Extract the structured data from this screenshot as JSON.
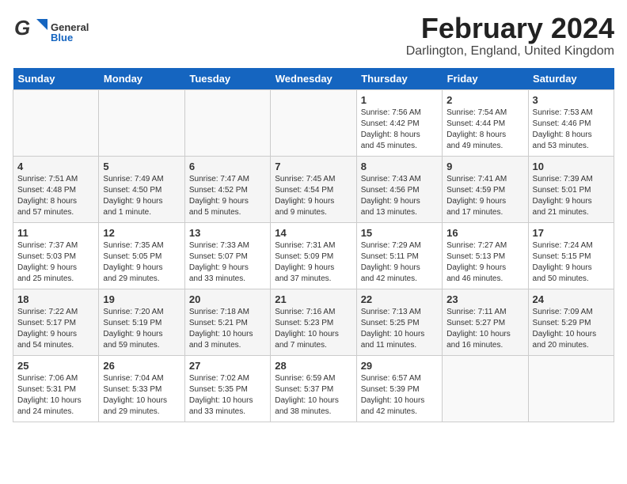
{
  "header": {
    "logo_general": "General",
    "logo_blue": "Blue",
    "month_year": "February 2024",
    "location": "Darlington, England, United Kingdom"
  },
  "weekdays": [
    "Sunday",
    "Monday",
    "Tuesday",
    "Wednesday",
    "Thursday",
    "Friday",
    "Saturday"
  ],
  "weeks": [
    [
      {
        "day": "",
        "info": ""
      },
      {
        "day": "",
        "info": ""
      },
      {
        "day": "",
        "info": ""
      },
      {
        "day": "",
        "info": ""
      },
      {
        "day": "1",
        "info": "Sunrise: 7:56 AM\nSunset: 4:42 PM\nDaylight: 8 hours\nand 45 minutes."
      },
      {
        "day": "2",
        "info": "Sunrise: 7:54 AM\nSunset: 4:44 PM\nDaylight: 8 hours\nand 49 minutes."
      },
      {
        "day": "3",
        "info": "Sunrise: 7:53 AM\nSunset: 4:46 PM\nDaylight: 8 hours\nand 53 minutes."
      }
    ],
    [
      {
        "day": "4",
        "info": "Sunrise: 7:51 AM\nSunset: 4:48 PM\nDaylight: 8 hours\nand 57 minutes."
      },
      {
        "day": "5",
        "info": "Sunrise: 7:49 AM\nSunset: 4:50 PM\nDaylight: 9 hours\nand 1 minute."
      },
      {
        "day": "6",
        "info": "Sunrise: 7:47 AM\nSunset: 4:52 PM\nDaylight: 9 hours\nand 5 minutes."
      },
      {
        "day": "7",
        "info": "Sunrise: 7:45 AM\nSunset: 4:54 PM\nDaylight: 9 hours\nand 9 minutes."
      },
      {
        "day": "8",
        "info": "Sunrise: 7:43 AM\nSunset: 4:56 PM\nDaylight: 9 hours\nand 13 minutes."
      },
      {
        "day": "9",
        "info": "Sunrise: 7:41 AM\nSunset: 4:59 PM\nDaylight: 9 hours\nand 17 minutes."
      },
      {
        "day": "10",
        "info": "Sunrise: 7:39 AM\nSunset: 5:01 PM\nDaylight: 9 hours\nand 21 minutes."
      }
    ],
    [
      {
        "day": "11",
        "info": "Sunrise: 7:37 AM\nSunset: 5:03 PM\nDaylight: 9 hours\nand 25 minutes."
      },
      {
        "day": "12",
        "info": "Sunrise: 7:35 AM\nSunset: 5:05 PM\nDaylight: 9 hours\nand 29 minutes."
      },
      {
        "day": "13",
        "info": "Sunrise: 7:33 AM\nSunset: 5:07 PM\nDaylight: 9 hours\nand 33 minutes."
      },
      {
        "day": "14",
        "info": "Sunrise: 7:31 AM\nSunset: 5:09 PM\nDaylight: 9 hours\nand 37 minutes."
      },
      {
        "day": "15",
        "info": "Sunrise: 7:29 AM\nSunset: 5:11 PM\nDaylight: 9 hours\nand 42 minutes."
      },
      {
        "day": "16",
        "info": "Sunrise: 7:27 AM\nSunset: 5:13 PM\nDaylight: 9 hours\nand 46 minutes."
      },
      {
        "day": "17",
        "info": "Sunrise: 7:24 AM\nSunset: 5:15 PM\nDaylight: 9 hours\nand 50 minutes."
      }
    ],
    [
      {
        "day": "18",
        "info": "Sunrise: 7:22 AM\nSunset: 5:17 PM\nDaylight: 9 hours\nand 54 minutes."
      },
      {
        "day": "19",
        "info": "Sunrise: 7:20 AM\nSunset: 5:19 PM\nDaylight: 9 hours\nand 59 minutes."
      },
      {
        "day": "20",
        "info": "Sunrise: 7:18 AM\nSunset: 5:21 PM\nDaylight: 10 hours\nand 3 minutes."
      },
      {
        "day": "21",
        "info": "Sunrise: 7:16 AM\nSunset: 5:23 PM\nDaylight: 10 hours\nand 7 minutes."
      },
      {
        "day": "22",
        "info": "Sunrise: 7:13 AM\nSunset: 5:25 PM\nDaylight: 10 hours\nand 11 minutes."
      },
      {
        "day": "23",
        "info": "Sunrise: 7:11 AM\nSunset: 5:27 PM\nDaylight: 10 hours\nand 16 minutes."
      },
      {
        "day": "24",
        "info": "Sunrise: 7:09 AM\nSunset: 5:29 PM\nDaylight: 10 hours\nand 20 minutes."
      }
    ],
    [
      {
        "day": "25",
        "info": "Sunrise: 7:06 AM\nSunset: 5:31 PM\nDaylight: 10 hours\nand 24 minutes."
      },
      {
        "day": "26",
        "info": "Sunrise: 7:04 AM\nSunset: 5:33 PM\nDaylight: 10 hours\nand 29 minutes."
      },
      {
        "day": "27",
        "info": "Sunrise: 7:02 AM\nSunset: 5:35 PM\nDaylight: 10 hours\nand 33 minutes."
      },
      {
        "day": "28",
        "info": "Sunrise: 6:59 AM\nSunset: 5:37 PM\nDaylight: 10 hours\nand 38 minutes."
      },
      {
        "day": "29",
        "info": "Sunrise: 6:57 AM\nSunset: 5:39 PM\nDaylight: 10 hours\nand 42 minutes."
      },
      {
        "day": "",
        "info": ""
      },
      {
        "day": "",
        "info": ""
      }
    ]
  ]
}
